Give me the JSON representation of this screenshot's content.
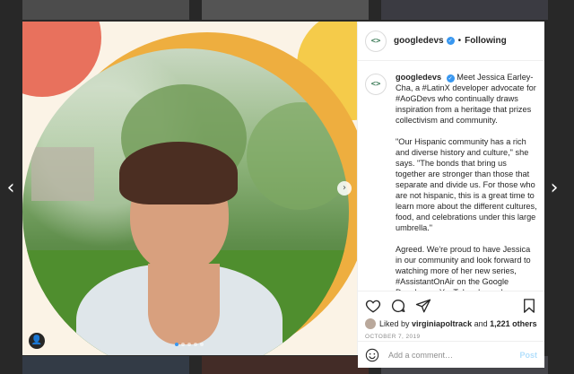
{
  "post": {
    "username": "googledevs",
    "follow_sep": "•",
    "follow_label": "Following",
    "avatar_glyph": "<>",
    "caption_paragraphs": [
      "Meet Jessica Earley-Cha, a #LatinX developer advocate for #AoGDevs who continually draws inspiration from a heritage that prizes collectivism and community.",
      "\"Our Hispanic community has a rich and diverse history and culture,\" she says. \"The bonds that bring us together are stronger than those that separate and divide us. For those who are not hispanic, this is a great time to learn more about the different cultures, food, and celebrations under this large umbrella.\"",
      "Agreed. We're proud to have Jessica in our community and look forward to watching more of her new series, #AssistantOnAir on the Google Developers YouTube channel."
    ],
    "liked_by_prefix": "Liked by",
    "liked_by_user": "virginiapoltrack",
    "liked_by_and": "and",
    "liked_by_others": "1,221 others",
    "date": "OCTOBER 7, 2019",
    "comment_placeholder": "Add a comment…",
    "post_label": "Post"
  },
  "icons": {
    "verified": "verified-badge-icon",
    "like": "heart-icon",
    "comment": "comment-icon",
    "share": "share-icon",
    "save": "bookmark-icon",
    "emoji": "emoji-icon",
    "prev": "chevron-left-icon",
    "next": "chevron-right-icon",
    "media_next": "chevron-right-icon",
    "user_tag": "person-icon"
  },
  "carousel": {
    "slide_count": 5,
    "active_index": 0
  },
  "colors": {
    "accent_blue": "#3897f0",
    "deco_red": "#e8715d",
    "deco_yellow": "#f5cb4a",
    "deco_orange": "#eeae3f",
    "brand_green": "#3b7a57"
  }
}
